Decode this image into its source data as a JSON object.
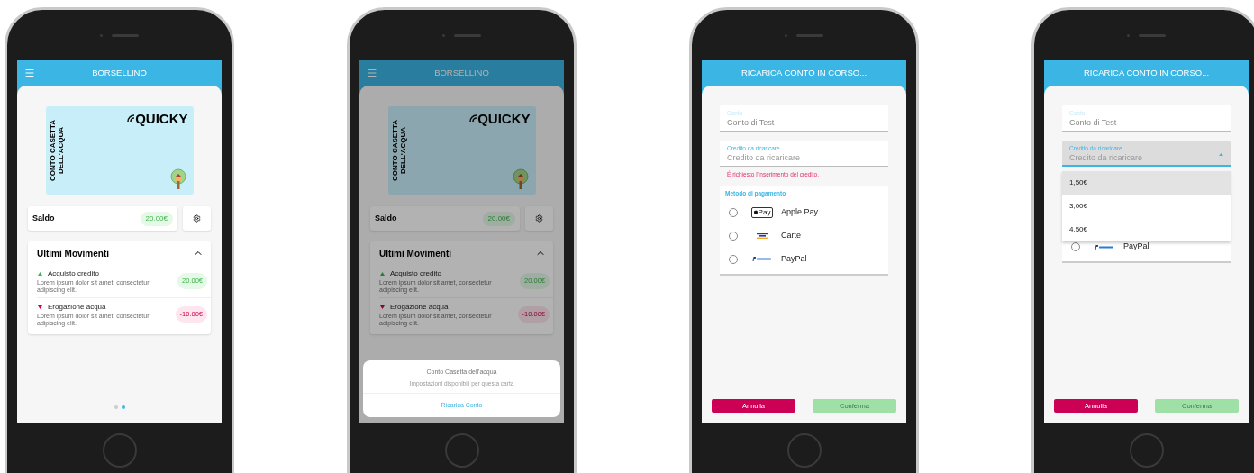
{
  "phones": [
    {
      "kind": "wallet",
      "dimmed": false,
      "header": {
        "title": "BORSELLINO"
      },
      "card": {
        "brand": "QUICKY",
        "side_text": [
          "CONTO CASETTA",
          "DELL'ACQUA"
        ]
      },
      "balance": {
        "label": "Saldo",
        "amount": "20.00€"
      },
      "movements": {
        "title": "Ultimi Movimenti",
        "expanded": true,
        "items": [
          {
            "kind": "credit",
            "title": "Acquisto credito",
            "description": "Lorem ipsum dolor sit amet, consectetur adipiscing elit.",
            "amount": "20.00€"
          },
          {
            "kind": "debit",
            "title": "Erogazione acqua",
            "description": "Lorem ipsum dolor sit amet, consectetur adipiscing elit.",
            "amount": "-10.00€"
          }
        ]
      },
      "pager": [
        {
          "selected": false
        },
        {
          "selected": true
        }
      ]
    },
    {
      "kind": "wallet",
      "dimmed": true,
      "header": {
        "title": "BORSELLINO"
      },
      "card": {
        "brand": "QUICKY",
        "side_text": [
          "CONTO CASETTA",
          "DELL'ACQUA"
        ]
      },
      "balance": {
        "label": "Saldo",
        "amount": "20.00€"
      },
      "movements": {
        "title": "Ultimi Movimenti",
        "expanded": true,
        "items": [
          {
            "kind": "credit",
            "title": "Acquisto credito",
            "description": "Lorem ipsum dolor sit amet, consectetur adipiscing elit.",
            "amount": "20.00€"
          },
          {
            "kind": "debit",
            "title": "Erogazione acqua",
            "description": "Lorem ipsum dolor sit amet, consectetur adipiscing elit.",
            "amount": "-10.00€"
          }
        ]
      },
      "action_sheet": {
        "title": "Conto Casetta dell'acqua",
        "subtitle": "Impostazioni disponibili per questa carta",
        "action": "Ricarica Conto"
      }
    },
    {
      "kind": "recharge",
      "header": {
        "title": "RICARICA CONTO IN CORSO..."
      },
      "fields": [
        {
          "label": "Conto",
          "value": "Conto di Test",
          "disabled": true,
          "focused": false
        },
        {
          "label": "Credito da ricaricare",
          "placeholder": "Credito da ricaricare",
          "disabled": false,
          "focused": false
        }
      ],
      "error": "É richiesto l'inserimento del credito.",
      "payment": {
        "title": "Metodo di pagamento",
        "options": [
          {
            "kind": "wallet",
            "badge": "Pay",
            "label": "Apple Pay",
            "selected": false
          },
          {
            "kind": "card",
            "label": "Carte",
            "selected": false
          },
          {
            "kind": "paypal",
            "label": "PayPal",
            "selected": false
          }
        ]
      },
      "buttons": [
        {
          "kind": "cancel",
          "label": "Annulla",
          "disabled": false
        },
        {
          "kind": "confirm",
          "label": "Conferma",
          "disabled": true
        }
      ]
    },
    {
      "kind": "recharge",
      "header": {
        "title": "RICARICA CONTO IN CORSO..."
      },
      "fields": [
        {
          "label": "Conto",
          "value": "Conto di Test",
          "disabled": true,
          "focused": false
        },
        {
          "label": "Credito da ricaricare",
          "placeholder": "Credito da ricaricare",
          "disabled": false,
          "focused": true,
          "options": [
            {
              "label": "1,50€",
              "selected": true
            },
            {
              "label": "3,00€",
              "selected": false
            },
            {
              "label": "4,50€",
              "selected": false
            }
          ]
        }
      ],
      "payment": {
        "options": [
          {
            "kind": "paypal",
            "label": "PayPal",
            "selected": false
          }
        ]
      },
      "buttons": [
        {
          "kind": "cancel",
          "label": "Annulla",
          "disabled": false
        },
        {
          "kind": "confirm",
          "label": "Conferma",
          "disabled": true
        }
      ]
    }
  ]
}
